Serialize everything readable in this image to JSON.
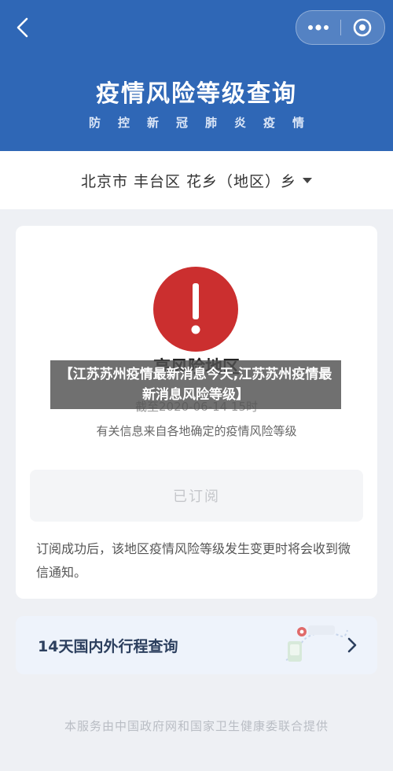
{
  "header": {
    "title": "疫情风险等级查询",
    "subtitle": "防控新冠肺炎疫情",
    "bg_color": "#2f67b6"
  },
  "nav": {
    "back_icon": "chevron-left-icon",
    "more_icon": "more-dots-icon",
    "close_icon": "target-circle-icon"
  },
  "location": {
    "text": "北京市 丰台区 花乡（地区）乡"
  },
  "risk_card": {
    "status_icon": "exclamation-icon",
    "risk_title": "高风险地区",
    "status_color": "#cb2f2f",
    "date_line": "截至2020-06-14 15时",
    "source_line": "有关信息来自各地确定的疫情风险等级",
    "subscribe_label": "已订阅",
    "notice": "订阅成功后，该地区疫情风险等级发生变更时将会收到微信通知。"
  },
  "trip_query": {
    "label": "14天国内外行程查询",
    "arrow_icon": "chevron-right-icon"
  },
  "footer": {
    "text": "本服务由中国政府网和国家卫生健康委联合提供"
  },
  "overlay": {
    "text": "【江苏苏州疫情最新消息今天,江苏苏州疫情最新消息风险等级】"
  }
}
